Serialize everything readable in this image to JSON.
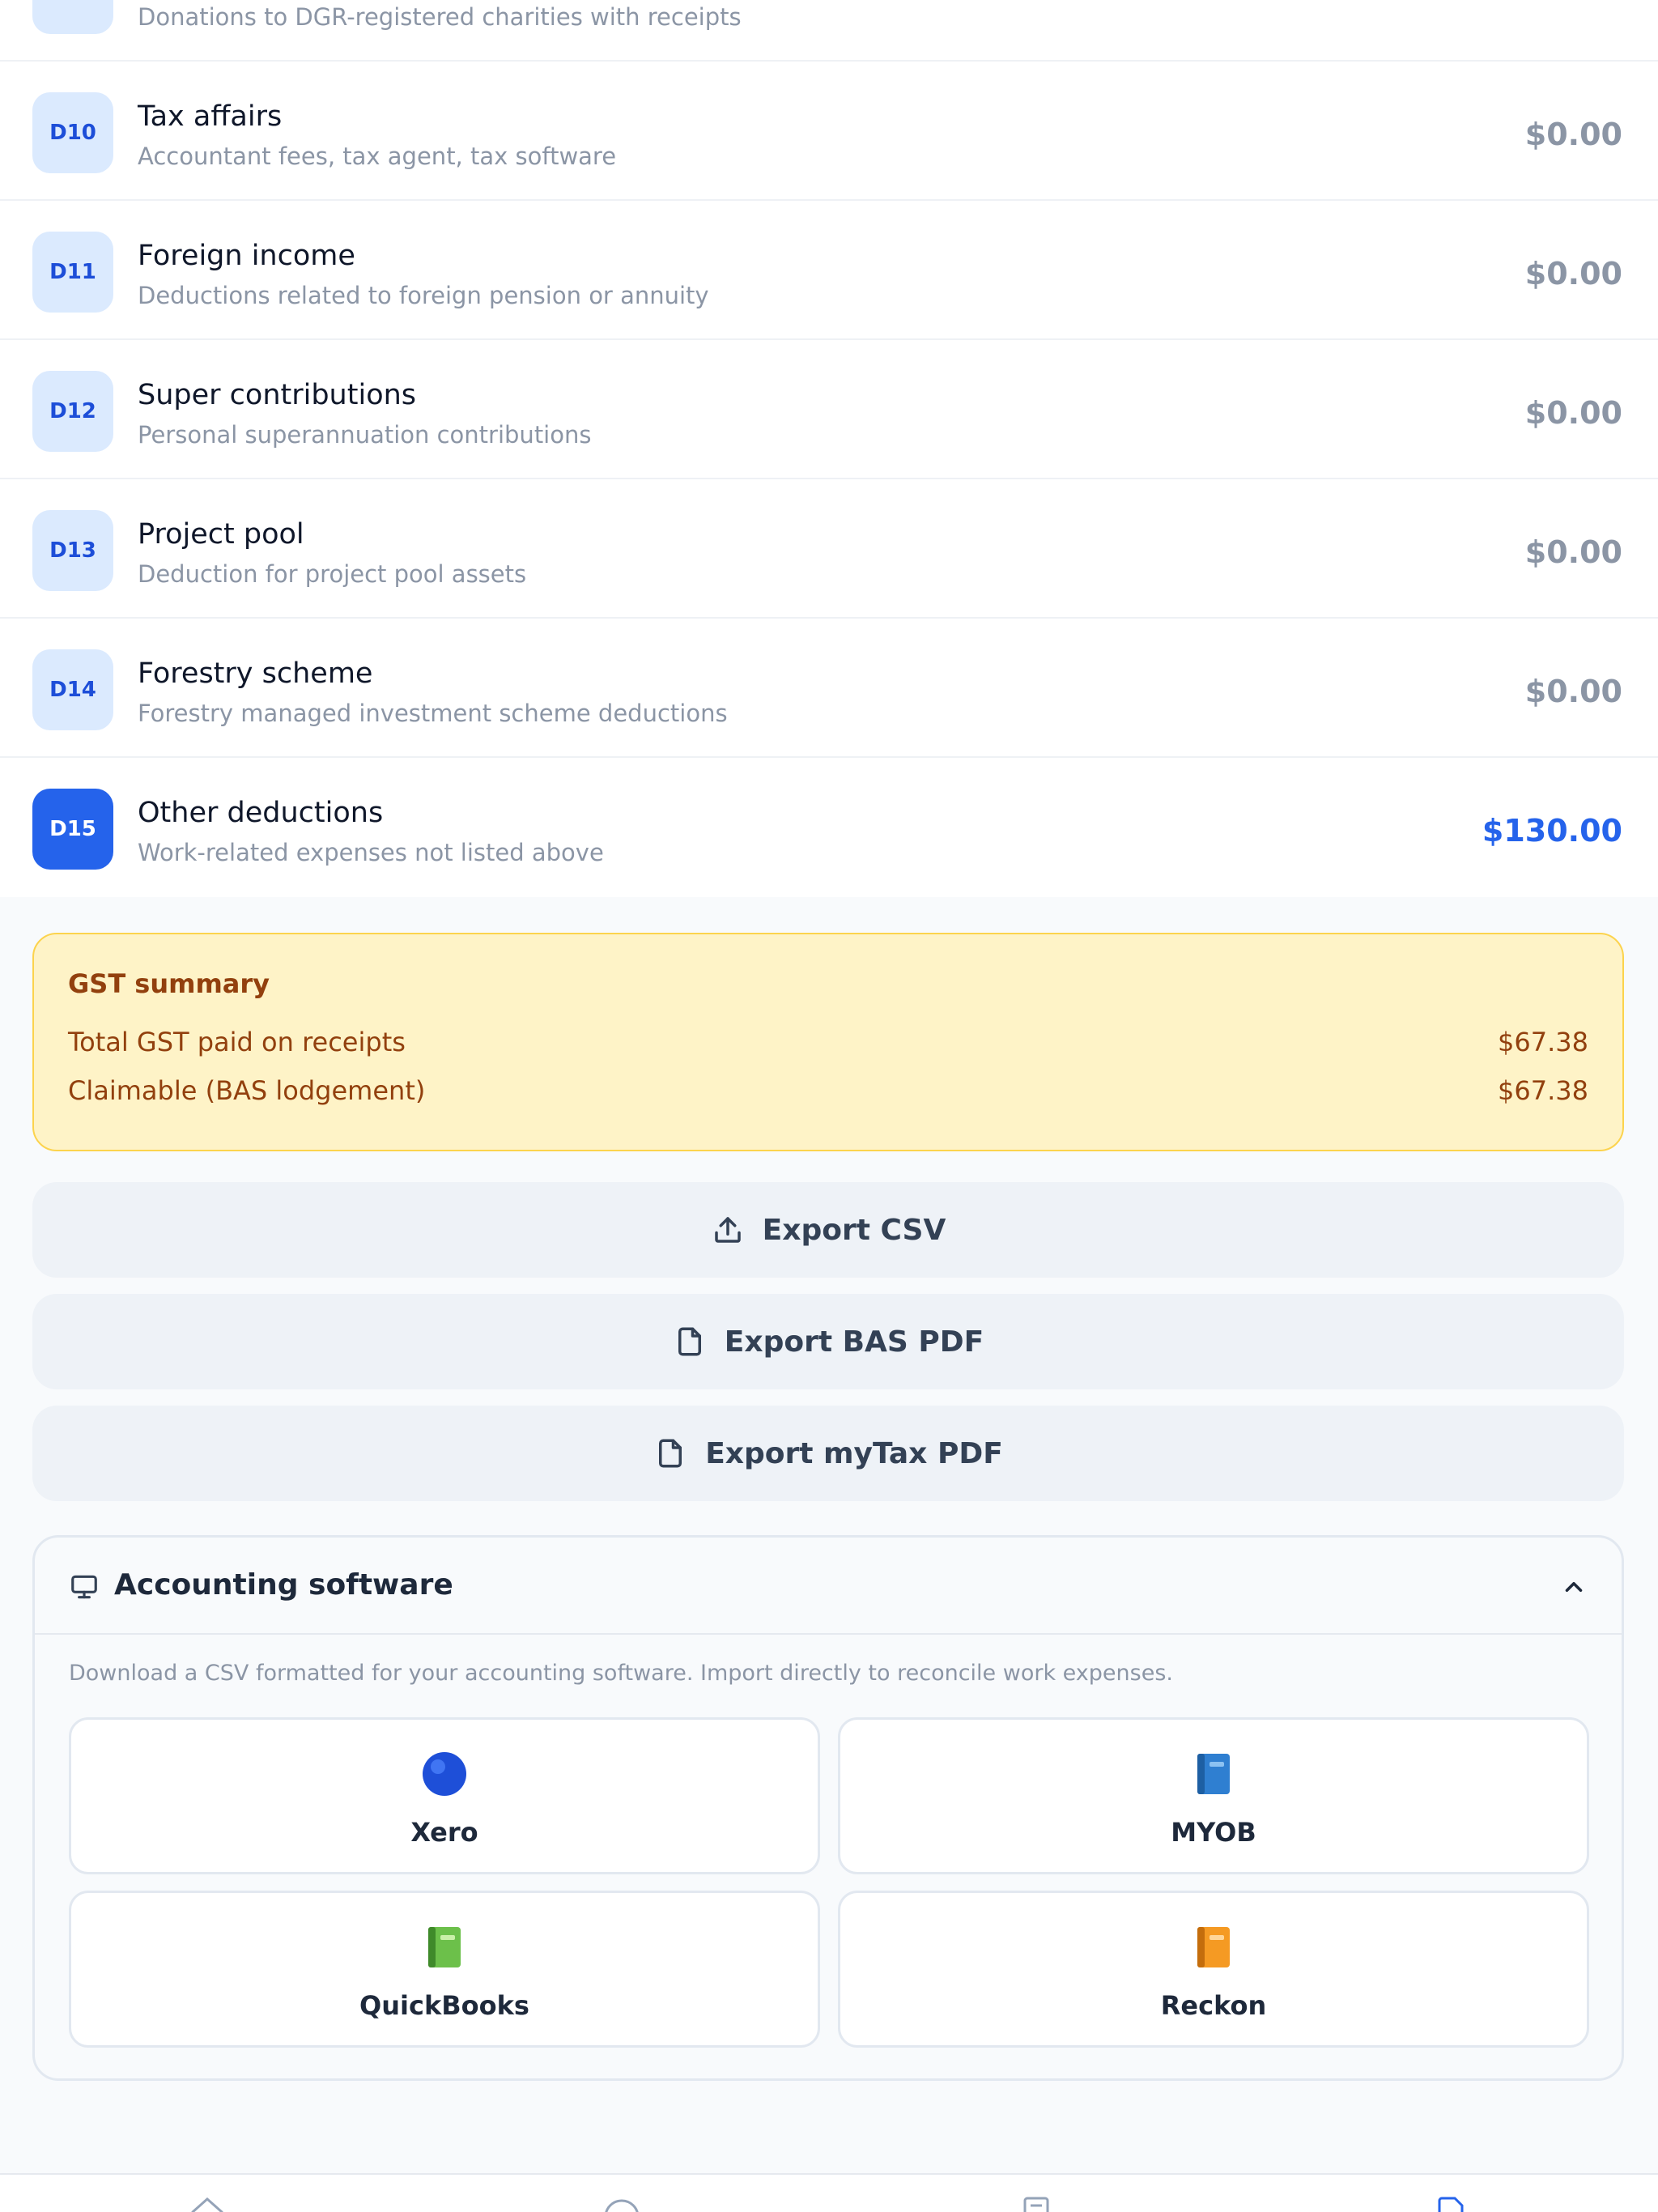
{
  "deductions": [
    {
      "code": "",
      "title": "",
      "subtitle": "Donations to DGR-registered charities with receipts",
      "amount": ""
    },
    {
      "code": "D10",
      "title": "Tax affairs",
      "subtitle": "Accountant fees, tax agent, tax software",
      "amount": "$0.00"
    },
    {
      "code": "D11",
      "title": "Foreign income",
      "subtitle": "Deductions related to foreign pension or annuity",
      "amount": "$0.00"
    },
    {
      "code": "D12",
      "title": "Super contributions",
      "subtitle": "Personal superannuation contributions",
      "amount": "$0.00"
    },
    {
      "code": "D13",
      "title": "Project pool",
      "subtitle": "Deduction for project pool assets",
      "amount": "$0.00"
    },
    {
      "code": "D14",
      "title": "Forestry scheme",
      "subtitle": "Forestry managed investment scheme deductions",
      "amount": "$0.00"
    },
    {
      "code": "D15",
      "title": "Other deductions",
      "subtitle": "Work-related expenses not listed above",
      "amount": "$130.00"
    }
  ],
  "gst": {
    "title": "GST summary",
    "total_label": "Total GST paid on receipts",
    "total_value": "$67.38",
    "claimable_label": "Claimable (BAS lodgement)",
    "claimable_value": "$67.38"
  },
  "exports": {
    "csv": "Export CSV",
    "bas_pdf": "Export BAS PDF",
    "mytax_pdf": "Export myTax PDF"
  },
  "accounting": {
    "title": "Accounting software",
    "description": "Download a CSV formatted for your accounting software. Import directly to reconcile work expenses.",
    "options": [
      {
        "label": "Xero",
        "icon": "blue-circle-icon"
      },
      {
        "label": "MYOB",
        "icon": "blue-book-icon"
      },
      {
        "label": "QuickBooks",
        "icon": "green-book-icon"
      },
      {
        "label": "Reckon",
        "icon": "orange-book-icon"
      }
    ]
  },
  "colors": {
    "accent": "#2563eb",
    "gst_background": "#fef3c7",
    "gst_text": "#92400e"
  }
}
